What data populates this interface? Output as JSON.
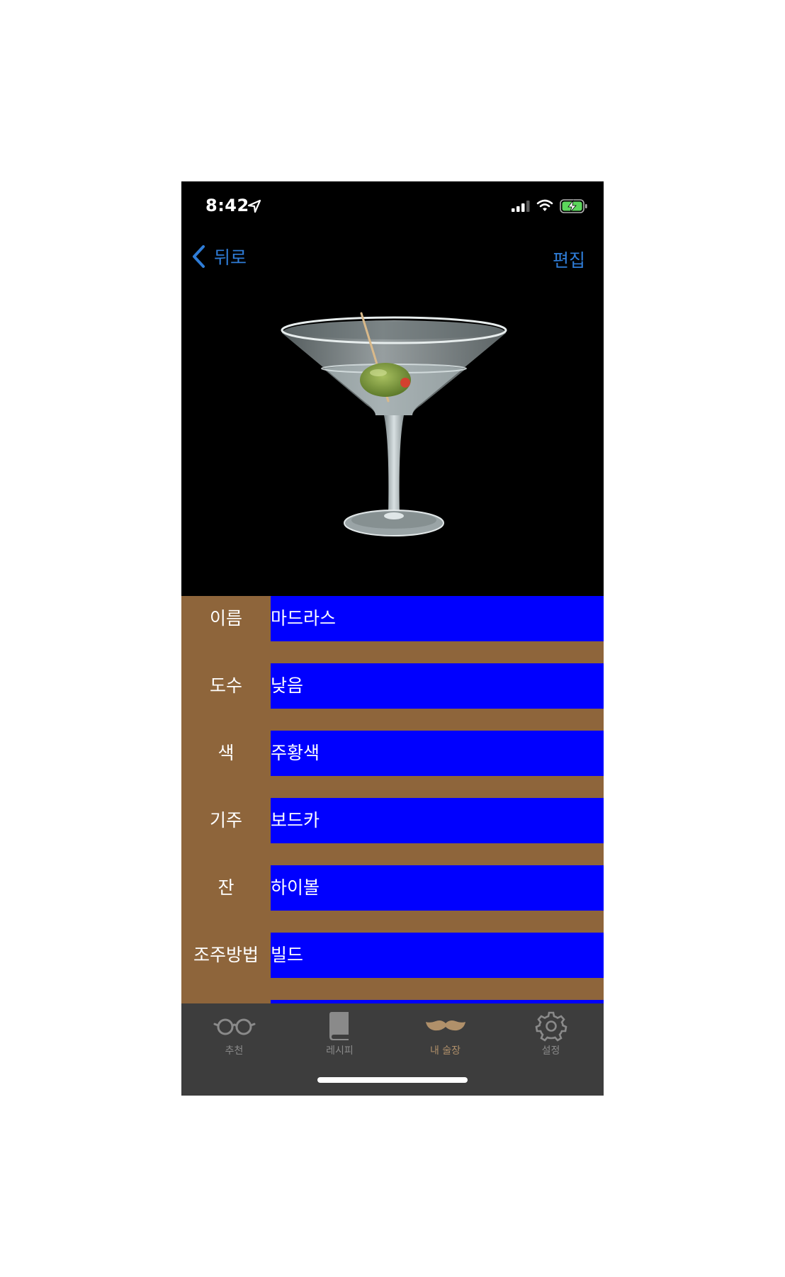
{
  "status_bar": {
    "time": "8:42"
  },
  "nav": {
    "back_label": "뒤로",
    "edit_label": "편집"
  },
  "colors": {
    "accent": "#2f7dd8",
    "table_background": "#8e653b",
    "value_background": "#0000ff",
    "tab_bar_background": "#3d3d3d",
    "tab_active": "#b0906a",
    "tab_inactive": "#8a8a8a"
  },
  "details": [
    {
      "label": "이름",
      "value": "마드라스"
    },
    {
      "label": "도수",
      "value": "낮음"
    },
    {
      "label": "색",
      "value": "주황색"
    },
    {
      "label": "기주",
      "value": "보드카"
    },
    {
      "label": "잔",
      "value": "하이볼"
    },
    {
      "label": "조주방법",
      "value": "빌드"
    }
  ],
  "tabs": [
    {
      "label": "추천",
      "icon": "glasses-icon",
      "active": false
    },
    {
      "label": "레시피",
      "icon": "book-icon",
      "active": false
    },
    {
      "label": "내 술장",
      "icon": "mustache-icon",
      "active": true
    },
    {
      "label": "설정",
      "icon": "gear-icon",
      "active": false
    }
  ]
}
